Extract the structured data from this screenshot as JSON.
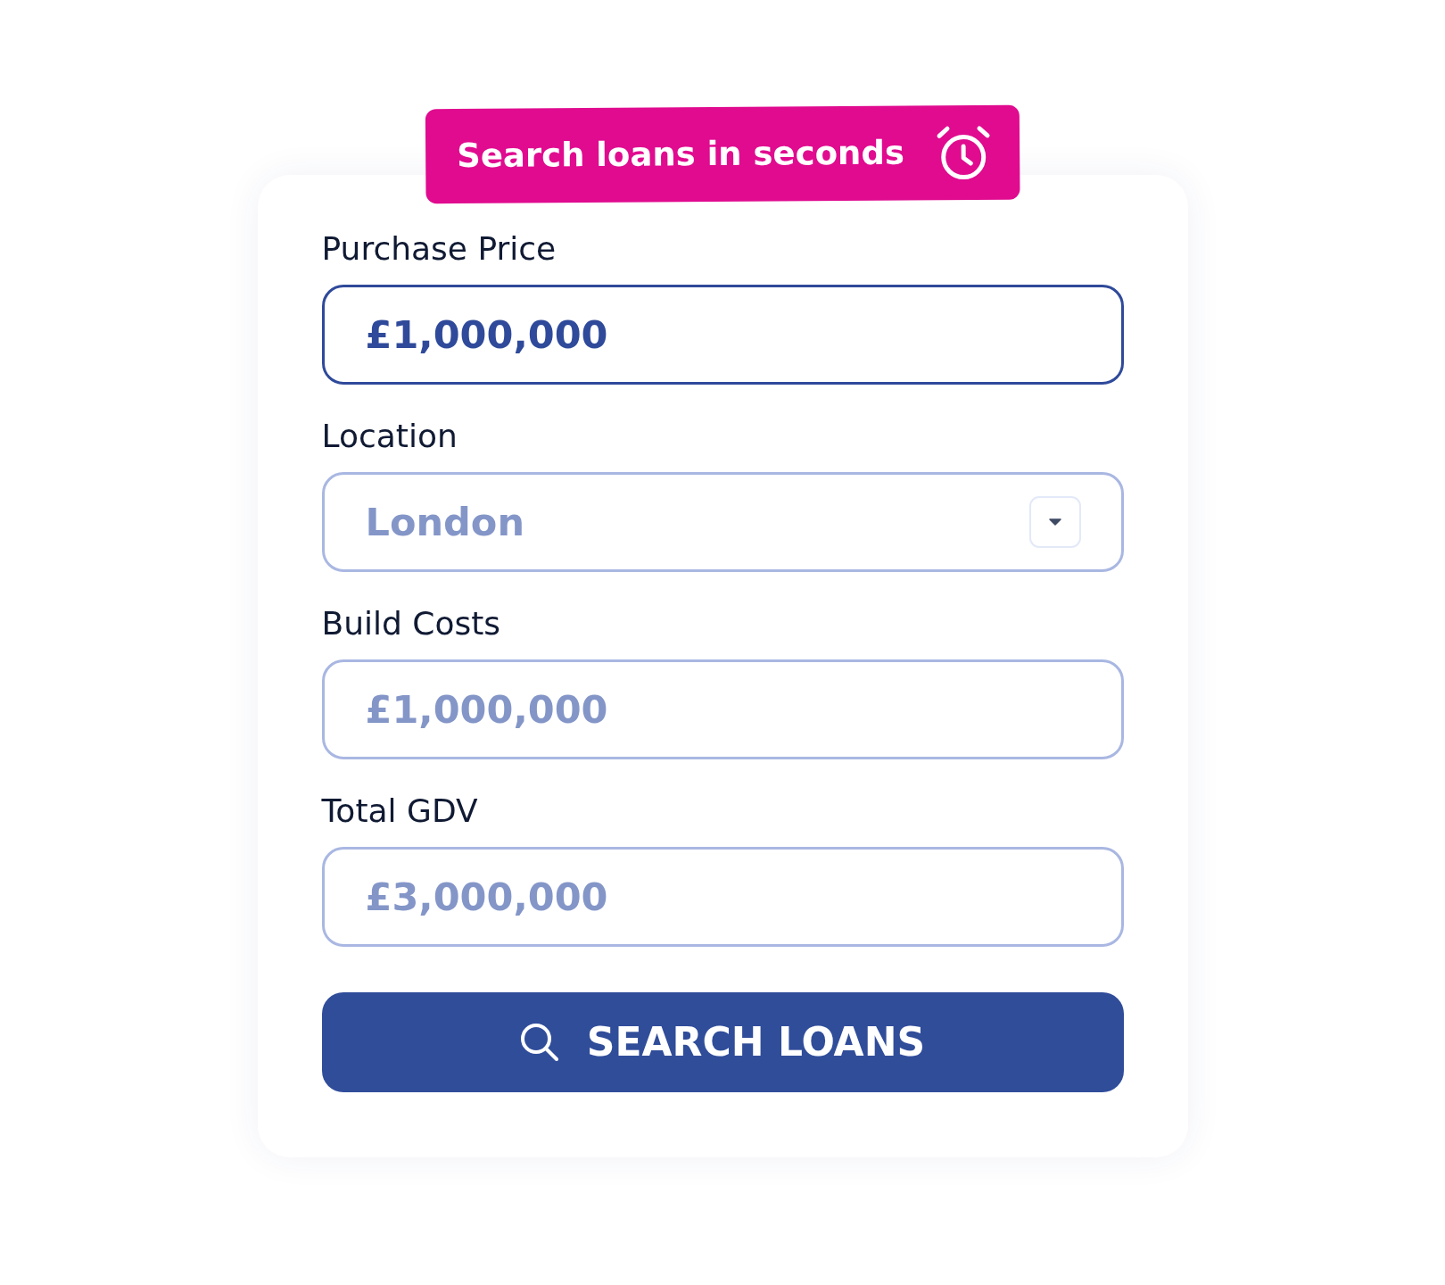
{
  "banner": {
    "text": "Search loans in seconds"
  },
  "fields": [
    {
      "label": "Purchase Price",
      "kind": "text",
      "value": "£1,000,000",
      "focused": true
    },
    {
      "label": "Location",
      "kind": "select",
      "value": "London",
      "focused": false
    },
    {
      "label": "Build Costs",
      "kind": "text",
      "value": "£1,000,000",
      "focused": false
    },
    {
      "label": "Total GDV",
      "kind": "text",
      "value": "£3,000,000",
      "focused": false
    }
  ],
  "submit_button": {
    "label": "SEARCH LOANS"
  }
}
